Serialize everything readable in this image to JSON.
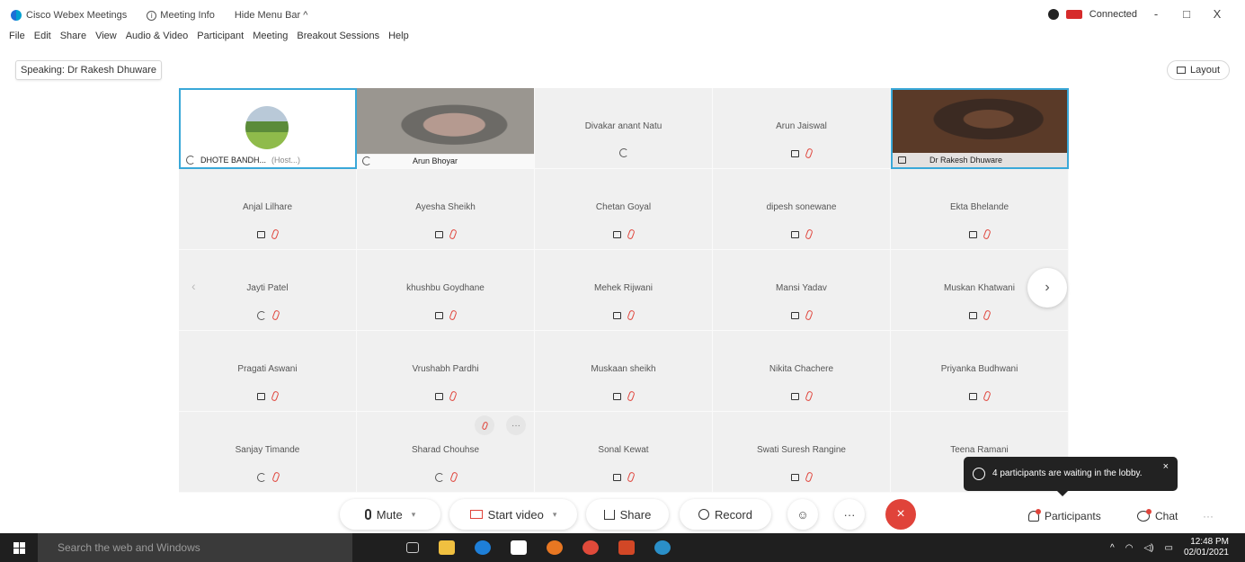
{
  "titlebar": {
    "app_name": "Cisco Webex Meetings",
    "meeting_info": "Meeting Info",
    "hide_menu": "Hide Menu Bar ^",
    "connection": "Connected",
    "window_controls": [
      "-",
      "□",
      "X"
    ]
  },
  "menu": [
    "File",
    "Edit",
    "Share",
    "View",
    "Audio & Video",
    "Participant",
    "Meeting",
    "Breakout Sessions",
    "Help"
  ],
  "speaking": "Speaking: Dr Rakesh Dhuware",
  "layout_label": "Layout",
  "tiles": [
    {
      "name": "DHOTE BANDH...",
      "host_tag": "(Host...)",
      "kind": "host"
    },
    {
      "name": "Arun Bhoyar",
      "kind": "video"
    },
    {
      "name": "Divakar anant Natu",
      "kind": "phone"
    },
    {
      "name": "Arun Jaiswal",
      "kind": "muted"
    },
    {
      "name": "Dr Rakesh Dhuware",
      "kind": "speaker"
    },
    {
      "name": "Anjal Lilhare",
      "kind": "muted"
    },
    {
      "name": "Ayesha Sheikh",
      "kind": "muted"
    },
    {
      "name": "Chetan Goyal",
      "kind": "muted"
    },
    {
      "name": "dipesh sonewane",
      "kind": "muted"
    },
    {
      "name": "Ekta Bhelande",
      "kind": "muted"
    },
    {
      "name": "Jayti Patel",
      "kind": "phone-muted"
    },
    {
      "name": "khushbu Goydhane",
      "kind": "muted"
    },
    {
      "name": "Mehek Rijwani",
      "kind": "muted"
    },
    {
      "name": "Mansi Yadav",
      "kind": "muted"
    },
    {
      "name": "Muskan Khatwani",
      "kind": "muted"
    },
    {
      "name": "Pragati Aswani",
      "kind": "muted"
    },
    {
      "name": "Vrushabh Pardhi",
      "kind": "muted"
    },
    {
      "name": "Muskaan sheikh",
      "kind": "muted"
    },
    {
      "name": "Nikita Chachere",
      "kind": "muted"
    },
    {
      "name": "Priyanka Budhwani",
      "kind": "muted"
    },
    {
      "name": "Sanjay Timande",
      "kind": "phone-muted"
    },
    {
      "name": "Sharad Chouhse",
      "kind": "phone-muted"
    },
    {
      "name": "Sonal Kewat",
      "kind": "muted"
    },
    {
      "name": "Swati Suresh Rangine",
      "kind": "muted"
    },
    {
      "name": "Teena Ramani",
      "kind": "muted"
    }
  ],
  "lobby_toast": "4 participants are waiting in the lobby.",
  "controls": {
    "mute": "Mute",
    "start_video": "Start video",
    "share": "Share",
    "record": "Record",
    "participants": "Participants",
    "chat": "Chat"
  },
  "taskbar": {
    "search_placeholder": "Search the web and Windows",
    "time": "12:48 PM",
    "date": "02/01/2021"
  },
  "colors": {
    "accent": "#3aa8d8",
    "end_call": "#e0433a",
    "muted": "#e0433a"
  }
}
